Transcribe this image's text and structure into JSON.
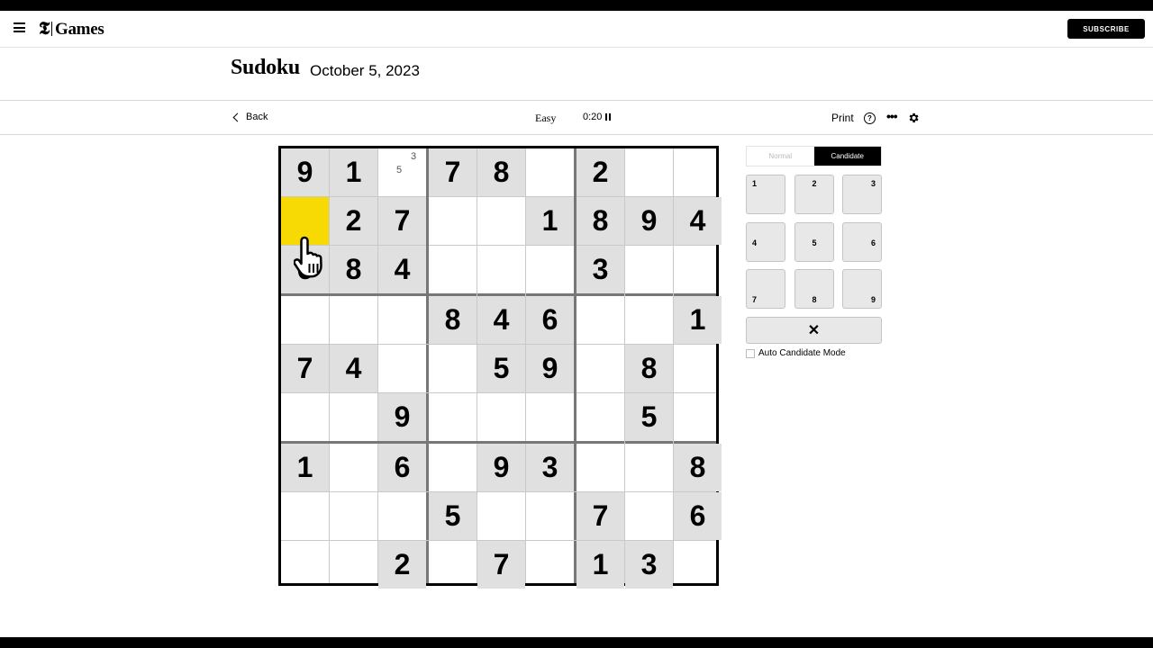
{
  "header": {
    "brand_mark": "𝕿",
    "brand_name": "Games",
    "subscribe_label": "SUBSCRIBE"
  },
  "puzzle": {
    "title": "Sudoku",
    "date": "October 5, 2023"
  },
  "toolbar": {
    "back_label": "Back",
    "difficulty": "Easy",
    "timer": "0:20",
    "print_label": "Print",
    "help_glyph": "?",
    "more_glyph": "•••"
  },
  "board": {
    "rows": [
      [
        "9",
        "1",
        "",
        "7",
        "8",
        "",
        "2",
        "",
        ""
      ],
      [
        "",
        "2",
        "7",
        "",
        "",
        "1",
        "8",
        "9",
        "4"
      ],
      [
        "6",
        "8",
        "4",
        "",
        "",
        "",
        "3",
        "",
        ""
      ],
      [
        "",
        "",
        "",
        "8",
        "4",
        "6",
        "",
        "",
        "1"
      ],
      [
        "7",
        "4",
        "",
        "",
        "5",
        "9",
        "",
        "8",
        ""
      ],
      [
        "",
        "",
        "9",
        "",
        "",
        "",
        "",
        "5",
        ""
      ],
      [
        "1",
        "",
        "6",
        "",
        "9",
        "3",
        "",
        "",
        "8"
      ],
      [
        "",
        "",
        "",
        "5",
        "",
        "",
        "7",
        "",
        "6"
      ],
      [
        "",
        "",
        "2",
        "",
        "7",
        "",
        "1",
        "3",
        ""
      ]
    ],
    "selected": [
      1,
      0
    ],
    "candidates": [
      {
        "row": 0,
        "col": 2,
        "values": [
          "3",
          "5"
        ]
      }
    ]
  },
  "panel": {
    "mode_normal": "Normal",
    "mode_candidate": "Candidate",
    "active_mode": "Candidate",
    "keys": [
      "1",
      "2",
      "3",
      "4",
      "5",
      "6",
      "7",
      "8",
      "9"
    ],
    "clear_glyph": "✕",
    "auto_candidate_label": "Auto Candidate Mode"
  },
  "colors": {
    "selected_cell": "#f7da03",
    "given_cell": "#e0e0e0"
  }
}
